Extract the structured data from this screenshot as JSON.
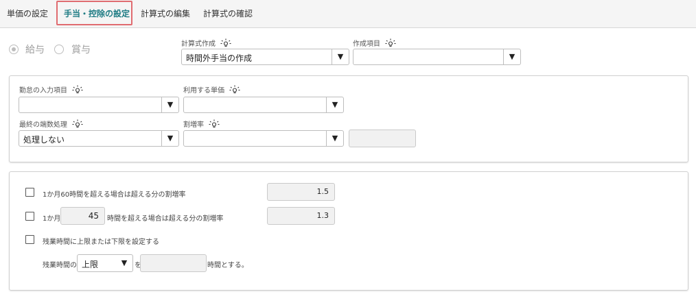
{
  "tabs": [
    {
      "label": "単価の設定"
    },
    {
      "label": "手当・控除の設定",
      "active": true
    },
    {
      "label": "計算式の編集"
    },
    {
      "label": "計算式の確認"
    }
  ],
  "pay_type": {
    "options": [
      "給与",
      "賞与"
    ],
    "selected": "給与"
  },
  "formula_creation": {
    "label": "計算式作成",
    "value": "時間外手当の作成"
  },
  "creation_item": {
    "label": "作成項目",
    "value": ""
  },
  "panel1": {
    "attendance_item": {
      "label": "勤怠の入力項目",
      "value": ""
    },
    "unit_price": {
      "label": "利用する単価",
      "value": ""
    },
    "rounding": {
      "label": "最終の端数処理",
      "value": "処理しない"
    },
    "premium_rate": {
      "label": "割増率",
      "value": "",
      "extra_value": ""
    }
  },
  "panel2": {
    "row1": {
      "text": "1か月60時間を超える場合は超える分の割増率",
      "rate": "1.5"
    },
    "row2": {
      "prefix": "1か月",
      "hours": "45",
      "suffix": "時間を超える場合は超える分の割増率",
      "rate": "1.3"
    },
    "row3": {
      "text": "残業時間に上限または下限を設定する"
    },
    "row4": {
      "prefix": "残業時間の",
      "limit": "上限",
      "connector": "を",
      "value": "",
      "suffix": "時間とする。"
    }
  },
  "icons": {
    "hint": "lightbulb-icon",
    "dropdown": "triangle-down-icon"
  },
  "colors": {
    "accent": "#1f7c84",
    "highlight_frame": "#e06b70"
  }
}
